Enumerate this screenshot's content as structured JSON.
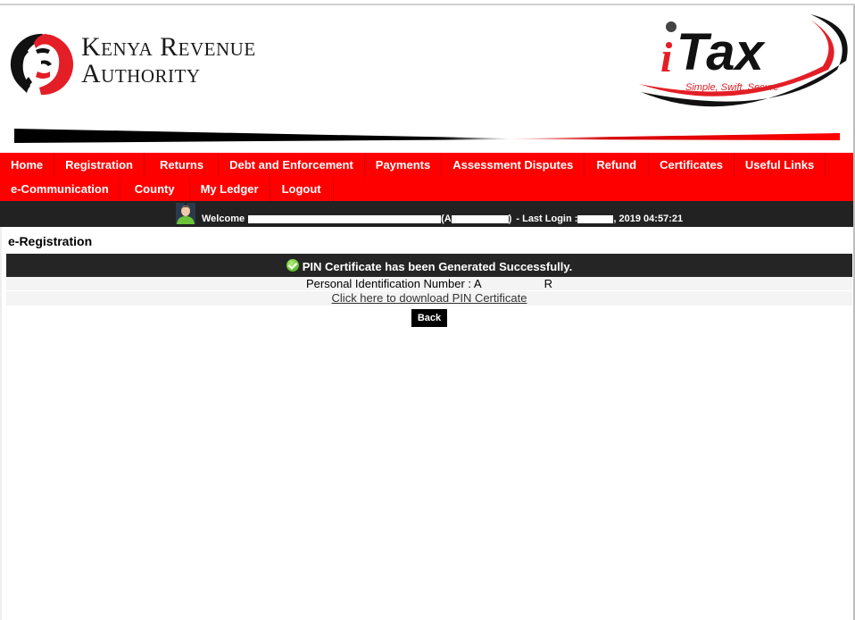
{
  "header": {
    "org_name_line1": "Kenya Revenue",
    "org_name_line2": "Authority",
    "itax_logo_text": "Tax",
    "itax_logo_i": "i",
    "itax_tagline": "Simple, Swift, Secure",
    "brand_colors": {
      "red": "#ff0000",
      "dark": "#222222"
    }
  },
  "nav": {
    "row1": [
      {
        "label": "Home"
      },
      {
        "label": "Registration"
      },
      {
        "label": "Returns"
      },
      {
        "label": "Debt and Enforcement"
      },
      {
        "label": "Payments"
      },
      {
        "label": "Assessment Disputes"
      },
      {
        "label": "Refund"
      },
      {
        "label": "Certificates"
      },
      {
        "label": "Useful Links"
      }
    ],
    "row2": [
      {
        "label": "e-Communication"
      },
      {
        "label": "County"
      },
      {
        "label": "My Ledger"
      },
      {
        "label": "Logout"
      }
    ]
  },
  "welcome_bar": {
    "welcome_label": "Welcome",
    "pin_open": "(A",
    "pin_close": ")",
    "last_login_label": " - Last Login :",
    "last_login_value": ", 2019 04:57:21"
  },
  "page": {
    "title": "e-Registration",
    "success_message": "PIN Certificate has been Generated Successfully.",
    "pin_label": "Personal Identification Number : A",
    "pin_suffix": "R",
    "download_link": "Click here to download PIN Certificate",
    "back_button": "Back"
  }
}
